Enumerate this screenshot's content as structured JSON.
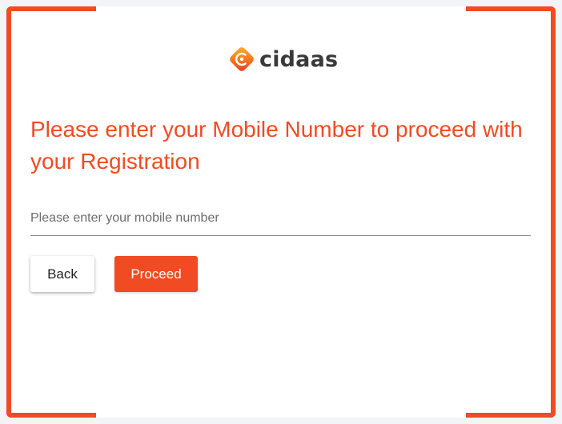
{
  "brand": {
    "name": "cidaas",
    "accent": "#f04b23"
  },
  "heading": "Please enter your Mobile Number to proceed with your Registration",
  "mobile_input": {
    "placeholder": "Please enter your mobile number",
    "value": ""
  },
  "buttons": {
    "back": "Back",
    "proceed": "Proceed"
  },
  "icons": {
    "logo": "cidaas-logo-icon"
  }
}
